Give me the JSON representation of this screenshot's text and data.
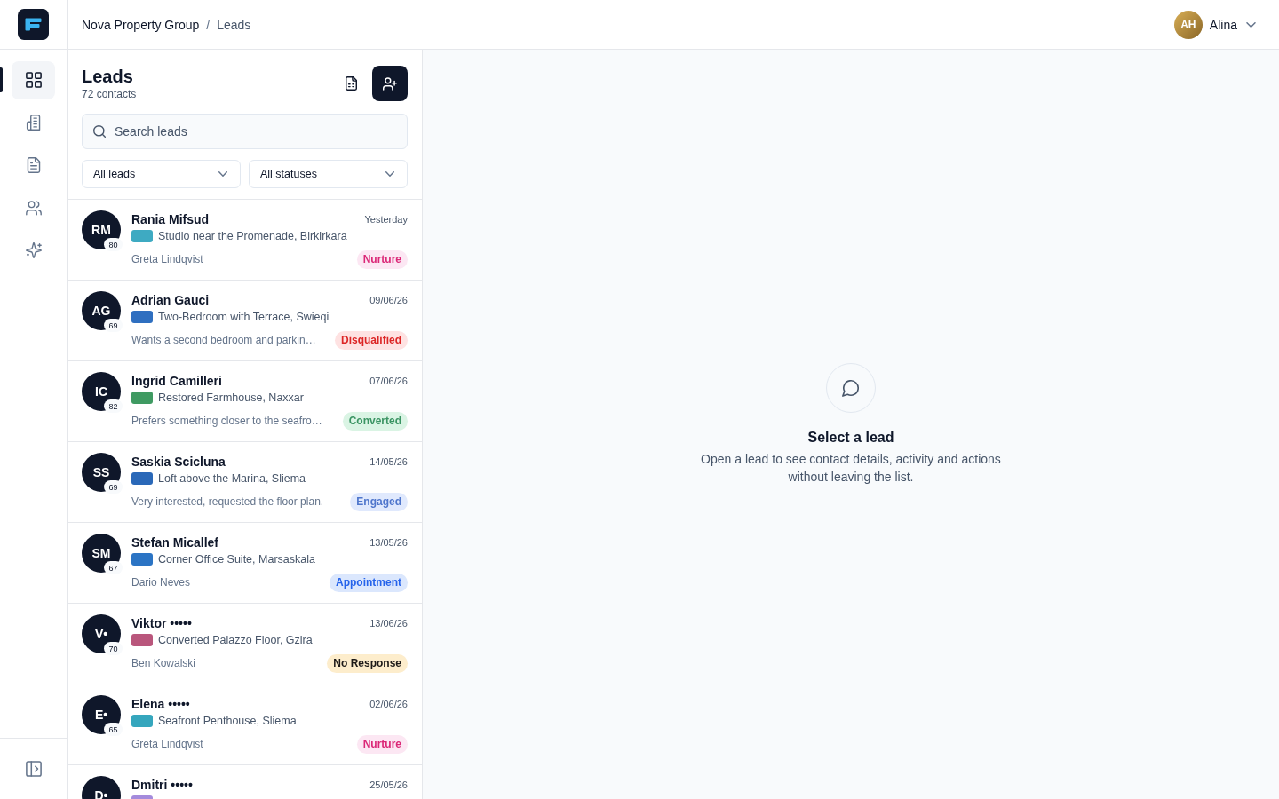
{
  "header": {
    "breadcrumb": [
      {
        "label": "Nova Property Group",
        "current": false
      },
      {
        "label": "Leads",
        "current": true
      }
    ],
    "separator": "/",
    "user": {
      "initials": "AH",
      "name": "Alina"
    }
  },
  "sidebar": {
    "items": [
      {
        "kind": "grid",
        "selected": true
      },
      {
        "kind": "building",
        "selected": false
      },
      {
        "kind": "document",
        "selected": false
      },
      {
        "kind": "users",
        "selected": false
      },
      {
        "kind": "sparkles",
        "selected": false
      }
    ]
  },
  "leads_panel": {
    "title": "Leads",
    "count": "72 contacts",
    "search": {
      "placeholder": "Search leads"
    },
    "filters": [
      {
        "value": "All leads"
      },
      {
        "value": "All statuses"
      }
    ],
    "leads": [
      {
        "initials": "RM",
        "score": "80",
        "name": "Rania Mifsud",
        "date": "Yesterday",
        "property": {
          "title": "Studio near the Promenade, Birkirkara",
          "color": "#3eaac2"
        },
        "subtitle": "Greta Lindqvist",
        "status": {
          "label": "Nurture",
          "kind": "nurture"
        }
      },
      {
        "initials": "AG",
        "score": "69",
        "name": "Adrian Gauci",
        "date": "09/06/26",
        "property": {
          "title": "Two-Bedroom with Terrace, Swieqi",
          "color": "#2f6fc0"
        },
        "subtitle": "Wants a second bedroom and parkin…",
        "status": {
          "label": "Disqualified",
          "kind": "disqualified"
        }
      },
      {
        "initials": "IC",
        "score": "82",
        "name": "Ingrid Camilleri",
        "date": "07/06/26",
        "property": {
          "title": "Restored Farmhouse, Naxxar",
          "color": "#3f9a62"
        },
        "subtitle": "Prefers something closer to the seafro…",
        "status": {
          "label": "Converted",
          "kind": "converted"
        }
      },
      {
        "initials": "SS",
        "score": "69",
        "name": "Saskia Scicluna",
        "date": "14/05/26",
        "property": {
          "title": "Loft above the Marina, Sliema",
          "color": "#2a68b8"
        },
        "subtitle": "Very interested, requested the floor plan.",
        "status": {
          "label": "Engaged",
          "kind": "engaged"
        }
      },
      {
        "initials": "SM",
        "score": "67",
        "name": "Stefan Micallef",
        "date": "13/05/26",
        "property": {
          "title": "Corner Office Suite, Marsaskala",
          "color": "#2b74c4"
        },
        "subtitle": "Dario Neves",
        "status": {
          "label": "Appointment",
          "kind": "appointment"
        }
      },
      {
        "initials": "V•",
        "score": "70",
        "name": "Viktor •••••",
        "date": "13/06/26",
        "property": {
          "title": "Converted Palazzo Floor, Gzira",
          "color": "#b9567c"
        },
        "subtitle": "Ben Kowalski",
        "status": {
          "label": "No Response",
          "kind": "no_response"
        }
      },
      {
        "initials": "E•",
        "score": "65",
        "name": "Elena •••••",
        "date": "02/06/26",
        "property": {
          "title": "Seafront Penthouse, Sliema",
          "color": "#35a6bd"
        },
        "subtitle": "Greta Lindqvist",
        "status": {
          "label": "Nurture",
          "kind": "nurture"
        }
      },
      {
        "initials": "D•",
        "name": "Dmitri •••••",
        "date": "25/05/26",
        "property": {
          "color": "#a48bdc"
        }
      }
    ]
  },
  "detail": {
    "title": "Select a lead",
    "text": "Open a lead to see contact details, activity and actions without leaving the list."
  }
}
